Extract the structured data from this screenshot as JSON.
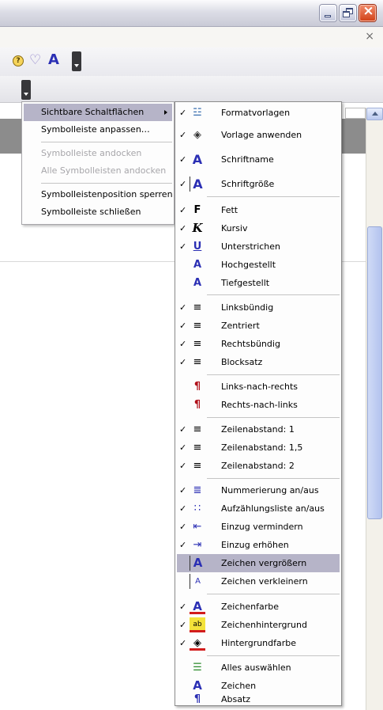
{
  "window": {
    "minimize_icon": "minimize-icon",
    "restore_icon": "restore-icon",
    "close_icon": "close-icon",
    "doc_close": "×"
  },
  "toolbar": {
    "icons": [
      "help-bubble-icon",
      "heart-icon",
      "font-color-icon"
    ],
    "font_glyph": "A"
  },
  "context_menu": {
    "items": [
      {
        "label": "Sichtbare Schaltflächen",
        "has_submenu": true,
        "highlighted": true,
        "disabled": false
      },
      {
        "label": "Symbolleiste anpassen…",
        "has_submenu": false,
        "highlighted": false,
        "disabled": false
      },
      {
        "label": "Symbolleiste andocken",
        "has_submenu": false,
        "highlighted": false,
        "disabled": true
      },
      {
        "label": "Alle Symbolleisten andocken",
        "has_submenu": false,
        "highlighted": false,
        "disabled": true
      },
      {
        "label": "Symbolleistenposition sperren",
        "has_submenu": false,
        "highlighted": false,
        "disabled": false
      },
      {
        "label": "Symbolleiste schließen",
        "has_submenu": false,
        "highlighted": false,
        "disabled": false
      }
    ]
  },
  "submenu": {
    "items": [
      {
        "label": "Formatvorlagen",
        "checked": true,
        "icon": "styles-icon",
        "glyph": "☳"
      },
      {
        "label": "Vorlage anwenden",
        "checked": true,
        "icon": "fill-format-icon",
        "glyph": "◈"
      },
      {
        "label": "Schriftname",
        "checked": true,
        "icon": "font-name-icon",
        "glyph": "A"
      },
      {
        "label": "Schriftgröße",
        "checked": true,
        "icon": "font-size-icon",
        "glyph": "A"
      },
      {
        "label": "Fett",
        "checked": true,
        "icon": "bold-icon",
        "glyph": "F"
      },
      {
        "label": "Kursiv",
        "checked": true,
        "icon": "italic-icon",
        "glyph": "K"
      },
      {
        "label": "Unterstrichen",
        "checked": true,
        "icon": "underline-icon",
        "glyph": "U"
      },
      {
        "label": "Hochgestellt",
        "checked": false,
        "icon": "superscript-icon",
        "glyph": "A"
      },
      {
        "label": "Tiefgestellt",
        "checked": false,
        "icon": "subscript-icon",
        "glyph": "A"
      },
      {
        "label": "Linksbündig",
        "checked": true,
        "icon": "align-left-icon",
        "glyph": "≡"
      },
      {
        "label": "Zentriert",
        "checked": true,
        "icon": "align-center-icon",
        "glyph": "≡"
      },
      {
        "label": "Rechtsbündig",
        "checked": true,
        "icon": "align-right-icon",
        "glyph": "≡"
      },
      {
        "label": "Blocksatz",
        "checked": true,
        "icon": "justify-icon",
        "glyph": "≡"
      },
      {
        "label": "Links-nach-rechts",
        "checked": false,
        "icon": "ltr-icon",
        "glyph": "¶"
      },
      {
        "label": "Rechts-nach-links",
        "checked": false,
        "icon": "rtl-icon",
        "glyph": "¶"
      },
      {
        "label": "Zeilenabstand: 1",
        "checked": true,
        "icon": "line-spacing-1-icon",
        "glyph": "≡"
      },
      {
        "label": "Zeilenabstand: 1,5",
        "checked": true,
        "icon": "line-spacing-15-icon",
        "glyph": "≡"
      },
      {
        "label": "Zeilenabstand: 2",
        "checked": true,
        "icon": "line-spacing-2-icon",
        "glyph": "≡"
      },
      {
        "label": "Nummerierung an/aus",
        "checked": true,
        "icon": "numbering-icon",
        "glyph": "≣"
      },
      {
        "label": "Aufzählungsliste an/aus",
        "checked": true,
        "icon": "bullets-icon",
        "glyph": "∷"
      },
      {
        "label": "Einzug vermindern",
        "checked": true,
        "icon": "decrease-indent-icon",
        "glyph": "⇤"
      },
      {
        "label": "Einzug erhöhen",
        "checked": true,
        "icon": "increase-indent-icon",
        "glyph": "⇥"
      },
      {
        "label": "Zeichen vergrößern",
        "checked": false,
        "icon": "grow-font-icon",
        "glyph": "A",
        "highlighted": true
      },
      {
        "label": "Zeichen verkleinern",
        "checked": false,
        "icon": "shrink-font-icon",
        "glyph": "A"
      },
      {
        "label": "Zeichenfarbe",
        "checked": true,
        "icon": "font-color-icon",
        "glyph": "A"
      },
      {
        "label": "Zeichenhintergrund",
        "checked": true,
        "icon": "highlight-icon",
        "glyph": "ab"
      },
      {
        "label": "Hintergrundfarbe",
        "checked": true,
        "icon": "background-color-icon",
        "glyph": "◈"
      },
      {
        "label": "Alles auswählen",
        "checked": false,
        "icon": "select-all-icon",
        "glyph": "☰"
      },
      {
        "label": "Zeichen",
        "checked": false,
        "icon": "character-icon",
        "glyph": "A"
      },
      {
        "label": "Absatz",
        "checked": false,
        "icon": "paragraph-icon",
        "glyph": "¶"
      }
    ]
  },
  "colors": {
    "accent_blue": "#2b2fb4",
    "highlight": "#b6b4c8",
    "red": "#d21c1c"
  }
}
